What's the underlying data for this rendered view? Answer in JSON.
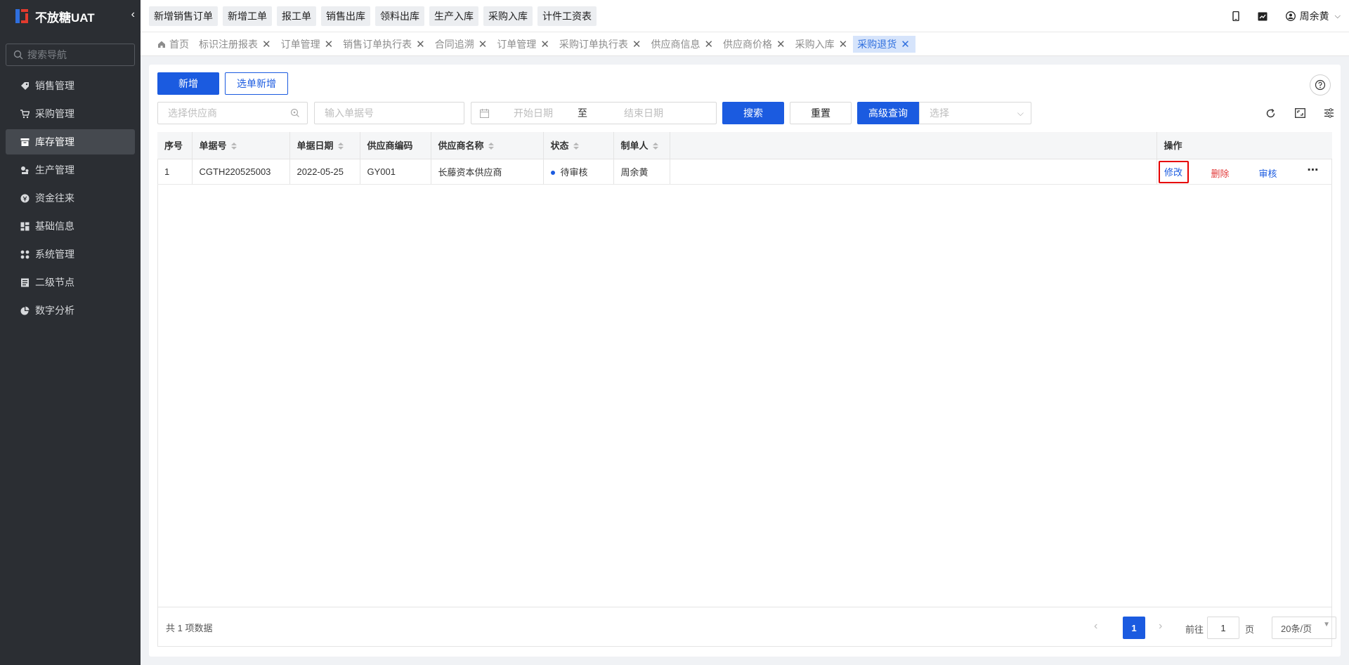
{
  "app": {
    "title": "不放糖UAT",
    "collapse_icon": "chevron-left-icon"
  },
  "sidebar": {
    "search_placeholder": "搜索导航",
    "items": [
      {
        "label": "销售管理",
        "icon": "tag-icon"
      },
      {
        "label": "采购管理",
        "icon": "cart-icon"
      },
      {
        "label": "库存管理",
        "icon": "warehouse-icon"
      },
      {
        "label": "生产管理",
        "icon": "production-icon"
      },
      {
        "label": "资金往来",
        "icon": "money-icon"
      },
      {
        "label": "基础信息",
        "icon": "grid-icon"
      },
      {
        "label": "系统管理",
        "icon": "apps-icon"
      },
      {
        "label": "二级节点",
        "icon": "list-icon"
      },
      {
        "label": "数字分析",
        "icon": "pie-chart-icon"
      }
    ],
    "active_index": 2
  },
  "quick_buttons": [
    "新增销售订单",
    "新增工单",
    "报工单",
    "销售出库",
    "领料出库",
    "生产入库",
    "采购入库",
    "计件工资表"
  ],
  "header": {
    "user_name": "周余黄"
  },
  "tabs": [
    {
      "label": "首页",
      "closable": false
    },
    {
      "label": "标识注册报表",
      "closable": true
    },
    {
      "label": "订单管理",
      "closable": true
    },
    {
      "label": "销售订单执行表",
      "closable": true
    },
    {
      "label": "合同追溯",
      "closable": true
    },
    {
      "label": "订单管理",
      "closable": true
    },
    {
      "label": "采购订单执行表",
      "closable": true
    },
    {
      "label": "供应商信息",
      "closable": true
    },
    {
      "label": "供应商价格",
      "closable": true
    },
    {
      "label": "采购入库",
      "closable": true
    },
    {
      "label": "采购退货",
      "closable": true,
      "active": true
    }
  ],
  "toolbar": {
    "add_label": "新增",
    "select_add_label": "选单新增",
    "supplier_placeholder": "选择供应商",
    "doc_no_placeholder": "输入单据号",
    "start_date_placeholder": "开始日期",
    "range_sep": "至",
    "end_date_placeholder": "结束日期",
    "search_label": "搜索",
    "reset_label": "重置",
    "advanced_label": "高级查询",
    "advanced_select_placeholder": "选择"
  },
  "table": {
    "columns": [
      "序号",
      "单据号",
      "单据日期",
      "供应商编码",
      "供应商名称",
      "状态",
      "制单人",
      "",
      "操作"
    ],
    "rows": [
      {
        "index": "1",
        "doc_no": "CGTH220525003",
        "date": "2022-05-25",
        "supplier_code": "GY001",
        "supplier_name": "长藤资本供应商",
        "status": "待审核",
        "creator": "周余黄"
      }
    ],
    "actions": {
      "edit": "修改",
      "delete": "删除",
      "audit": "审核"
    }
  },
  "pagination": {
    "total_text": "共 1 项数据",
    "current_page": "1",
    "goto_label": "前往",
    "goto_value": "1",
    "page_suffix": "页",
    "page_size": "20条/页"
  },
  "colors": {
    "primary": "#1b5be0",
    "danger": "#e23b3b",
    "sidebar_bg": "#2b2e33",
    "highlight_border": "#e60000"
  }
}
